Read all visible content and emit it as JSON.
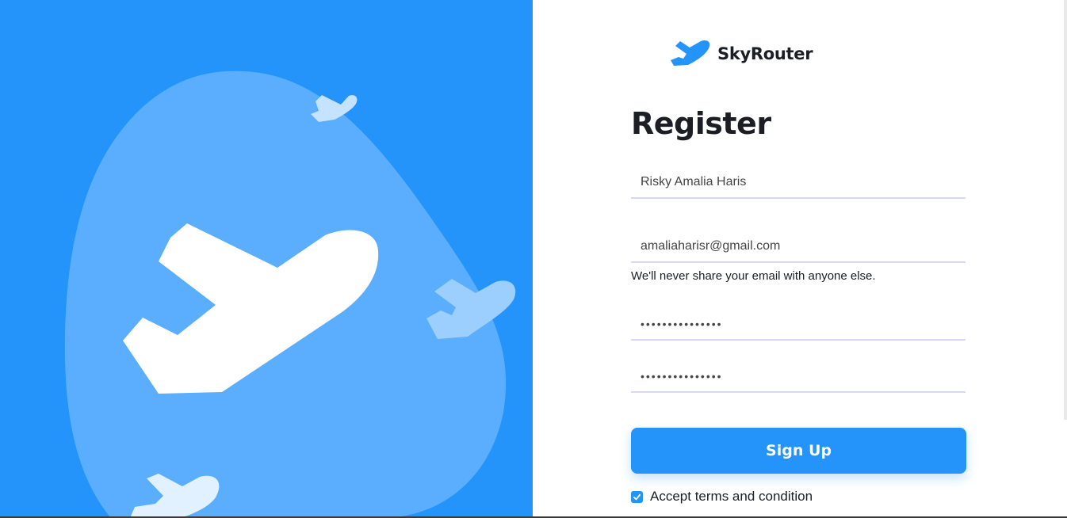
{
  "brand": {
    "name": "SkyRouter",
    "icon": "airplane-icon"
  },
  "form": {
    "title": "Register",
    "name_value": "Risky Amalia Haris",
    "email_value": "amaliaharisr@gmail.com",
    "email_help": "We'll never share your email with anyone else.",
    "password_value": "•••••••••••••••",
    "confirm_password_value": "•••••••••••••••",
    "submit_label": "Sign Up",
    "terms_label": "Accept terms and condition",
    "terms_checked": true
  },
  "colors": {
    "primary": "#2494fb",
    "blob": "#5aaefd",
    "text": "#1c1e26",
    "input_border": "#d8d8f5"
  }
}
